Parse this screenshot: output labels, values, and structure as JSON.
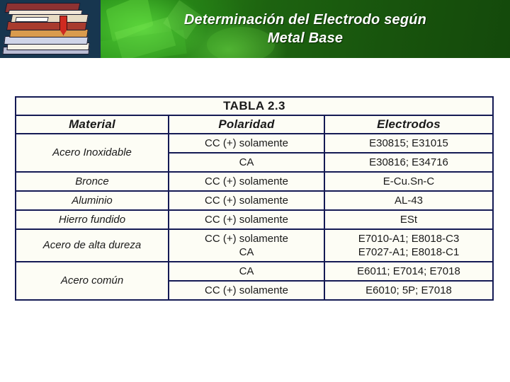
{
  "banner": {
    "title_line1": "Determinación del Electrodo según",
    "title_line2": "Metal Base",
    "clipart_name": "stack-of-books",
    "colors": {
      "green": "#1d5c12",
      "books_background": "#17364f",
      "title_text": "#ffffff"
    }
  },
  "table": {
    "title": "TABLA 2.3",
    "colors": {
      "header_background": "#0d1550",
      "border": "#141a54",
      "cell_background": "#fdfdf5"
    },
    "columns": [
      "Material",
      "Polaridad",
      "Electrodos"
    ],
    "rows": [
      {
        "material": "Acero Inoxidable",
        "entries": [
          {
            "polaridad": "CC (+)  solamente",
            "electrodos": "E30815; E31015"
          },
          {
            "polaridad": "CA",
            "electrodos": "E30816; E34716"
          }
        ]
      },
      {
        "material": "Bronce",
        "entries": [
          {
            "polaridad": "CC (+) solamente",
            "electrodos": "E-Cu.Sn-C"
          }
        ]
      },
      {
        "material": "Aluminio",
        "entries": [
          {
            "polaridad": "CC (+) solamente",
            "electrodos": "AL-43"
          }
        ]
      },
      {
        "material": "Hierro fundido",
        "entries": [
          {
            "polaridad": "CC (+) solamente",
            "electrodos": "ESt"
          }
        ]
      },
      {
        "material": "Acero de alta dureza",
        "entries": [
          {
            "polaridad": "CC (+) solamente",
            "electrodos": "E7010-A1; E8018-C3"
          },
          {
            "polaridad": "CA",
            "electrodos": "E7027-A1; E8018-C1"
          }
        ],
        "merged_polaridad": "CC (+) solamente\nCA",
        "merged_electrodos": "E7010-A1; E8018-C3\nE7027-A1; E8018-C1"
      },
      {
        "material": "Acero común",
        "entries": [
          {
            "polaridad": "CA",
            "electrodos": "E6011; E7014; E7018"
          },
          {
            "polaridad": "CC (+) solamente",
            "electrodos": "E6010; 5P; E7018"
          }
        ]
      }
    ]
  }
}
